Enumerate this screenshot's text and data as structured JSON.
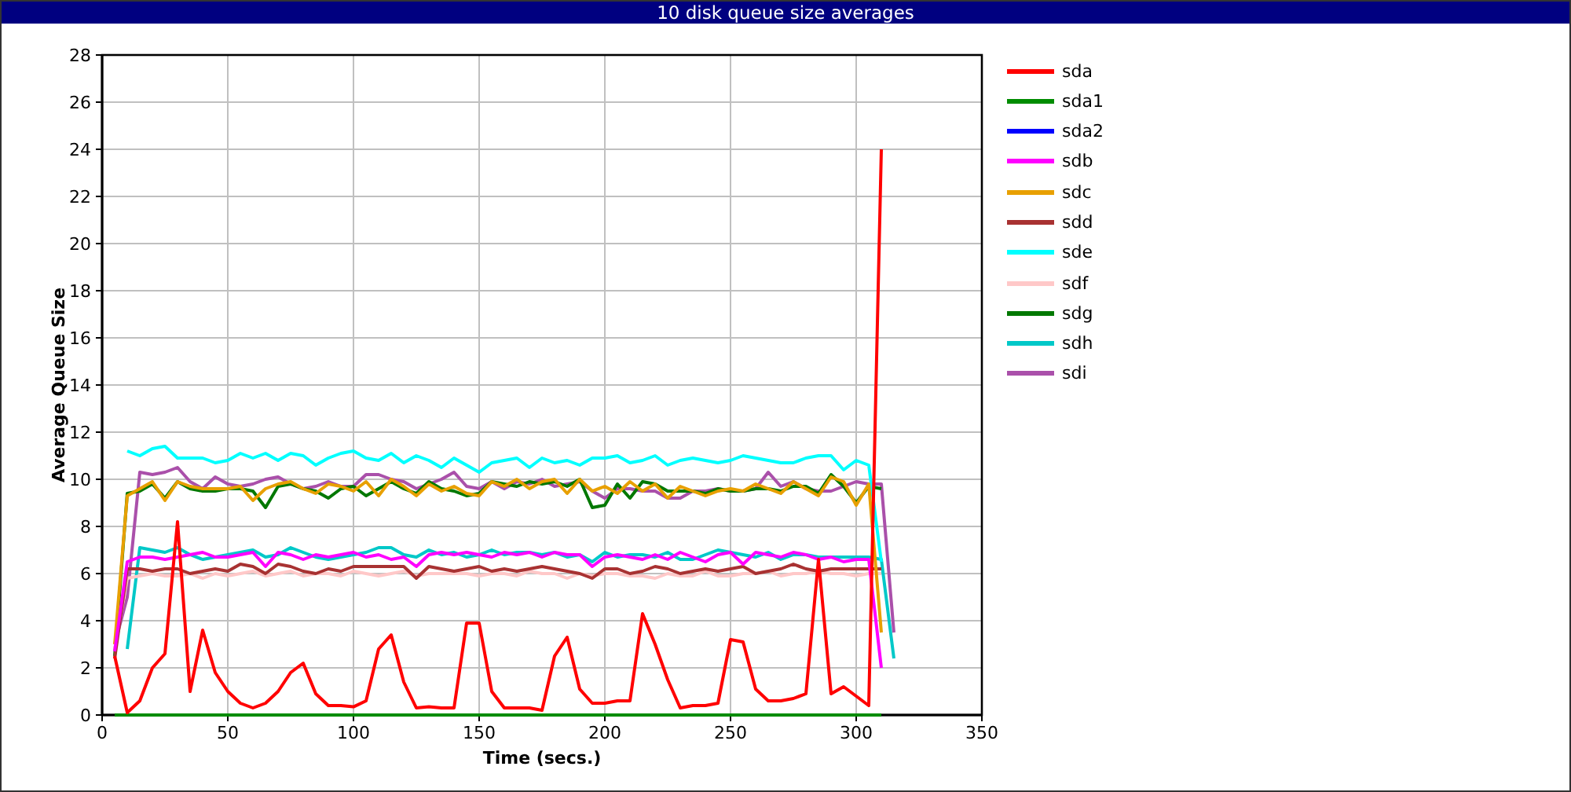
{
  "window": {
    "title": "10 disk queue size averages"
  },
  "chart": {
    "chart_data": {
      "type": "line",
      "grid": true,
      "xlabel": "Time (secs.)",
      "ylabel": "Average Queue Size",
      "xlim": [
        0,
        350
      ],
      "ylim": [
        0,
        28
      ],
      "xticks": [
        0,
        50,
        100,
        150,
        200,
        250,
        300,
        350
      ],
      "yticks": [
        0,
        2,
        4,
        6,
        8,
        10,
        12,
        14,
        16,
        18,
        20,
        22,
        24,
        26,
        28
      ],
      "x": [
        5,
        10,
        15,
        20,
        25,
        30,
        35,
        40,
        45,
        50,
        55,
        60,
        65,
        70,
        75,
        80,
        85,
        90,
        95,
        100,
        105,
        110,
        115,
        120,
        125,
        130,
        135,
        140,
        145,
        150,
        155,
        160,
        165,
        170,
        175,
        180,
        185,
        190,
        195,
        200,
        205,
        210,
        215,
        220,
        225,
        230,
        235,
        240,
        245,
        250,
        255,
        260,
        265,
        270,
        275,
        280,
        285,
        290,
        295,
        300,
        305,
        310,
        315
      ],
      "series": [
        {
          "name": "sda",
          "color": "#ff0000",
          "values": [
            2.5,
            0.1,
            0.6,
            2.0,
            2.6,
            8.2,
            1.0,
            3.6,
            1.8,
            1.0,
            0.5,
            0.3,
            0.5,
            1.0,
            1.8,
            2.2,
            0.9,
            0.4,
            0.4,
            0.35,
            0.6,
            2.8,
            3.4,
            1.4,
            0.3,
            0.35,
            0.3,
            0.3,
            3.9,
            3.9,
            1.0,
            0.3,
            0.3,
            0.3,
            0.2,
            2.5,
            3.3,
            1.1,
            0.5,
            0.5,
            0.6,
            0.6,
            4.3,
            3.0,
            1.5,
            0.3,
            0.4,
            0.4,
            0.5,
            3.2,
            3.1,
            1.1,
            0.6,
            0.6,
            0.7,
            0.9,
            6.6,
            0.9,
            1.2,
            0.8,
            0.4,
            24,
            null
          ]
        },
        {
          "name": "sda1",
          "color": "#008c00",
          "values": [
            0,
            0,
            0,
            0,
            0,
            0,
            0,
            0,
            0,
            0,
            0,
            0,
            0,
            0,
            0,
            0,
            0,
            0,
            0,
            0,
            0,
            0,
            0,
            0,
            0,
            0,
            0,
            0,
            0,
            0,
            0,
            0,
            0,
            0,
            0,
            0,
            0,
            0,
            0,
            0,
            0,
            0,
            0,
            0,
            0,
            0,
            0,
            0,
            0,
            0,
            0,
            0,
            0,
            0,
            0,
            0,
            0,
            0,
            0,
            0,
            0,
            0,
            null
          ]
        },
        {
          "name": "sda2",
          "color": "#0000ff",
          "values": [
            null,
            null,
            null,
            null,
            null,
            null,
            null,
            null,
            null,
            null,
            null,
            null,
            null,
            null,
            null,
            null,
            null,
            null,
            null,
            null,
            null,
            null,
            null,
            null,
            null,
            null,
            null,
            null,
            null,
            null,
            null,
            null,
            null,
            null,
            null,
            null,
            null,
            null,
            null,
            null,
            null,
            null,
            null,
            null,
            null,
            null,
            null,
            null,
            null,
            null,
            null,
            null,
            null,
            null,
            null,
            null,
            null,
            null,
            null,
            null,
            null,
            null,
            null
          ]
        },
        {
          "name": "sdb",
          "color": "#ff00ff",
          "values": [
            2.7,
            6.5,
            6.7,
            6.7,
            6.6,
            6.7,
            6.8,
            6.9,
            6.7,
            6.7,
            6.8,
            6.9,
            6.3,
            6.9,
            6.8,
            6.6,
            6.8,
            6.7,
            6.8,
            6.9,
            6.7,
            6.8,
            6.6,
            6.7,
            6.3,
            6.8,
            6.9,
            6.8,
            6.9,
            6.8,
            6.7,
            6.9,
            6.8,
            6.9,
            6.7,
            6.9,
            6.8,
            6.8,
            6.3,
            6.7,
            6.8,
            6.7,
            6.6,
            6.8,
            6.6,
            6.9,
            6.7,
            6.5,
            6.8,
            6.9,
            6.4,
            6.9,
            6.8,
            6.7,
            6.9,
            6.8,
            6.6,
            6.7,
            6.5,
            6.6,
            6.6,
            2.0,
            null
          ]
        },
        {
          "name": "sdc",
          "color": "#e8a000",
          "values": [
            3.0,
            9.3,
            9.6,
            9.9,
            9.1,
            9.9,
            9.7,
            9.6,
            9.6,
            9.6,
            9.7,
            9.1,
            9.6,
            9.8,
            9.9,
            9.6,
            9.4,
            9.8,
            9.7,
            9.5,
            9.9,
            9.3,
            10.0,
            9.7,
            9.3,
            9.8,
            9.5,
            9.7,
            9.4,
            9.3,
            9.9,
            9.7,
            10.0,
            9.6,
            9.9,
            10.0,
            9.4,
            10.0,
            9.5,
            9.7,
            9.4,
            9.9,
            9.5,
            9.8,
            9.2,
            9.7,
            9.5,
            9.3,
            9.5,
            9.6,
            9.5,
            9.8,
            9.6,
            9.4,
            9.9,
            9.6,
            9.3,
            10.1,
            9.9,
            8.9,
            9.8,
            3.5,
            null
          ]
        },
        {
          "name": "sdd",
          "color": "#a83232",
          "values": [
            2.4,
            6.2,
            6.2,
            6.1,
            6.2,
            6.2,
            6.0,
            6.1,
            6.2,
            6.1,
            6.4,
            6.3,
            6.0,
            6.4,
            6.3,
            6.1,
            6.0,
            6.2,
            6.1,
            6.3,
            6.3,
            6.3,
            6.3,
            6.3,
            5.8,
            6.3,
            6.2,
            6.1,
            6.2,
            6.3,
            6.1,
            6.2,
            6.1,
            6.2,
            6.3,
            6.2,
            6.1,
            6.0,
            5.8,
            6.2,
            6.2,
            6.0,
            6.1,
            6.3,
            6.2,
            6.0,
            6.1,
            6.2,
            6.1,
            6.2,
            6.3,
            6.0,
            6.1,
            6.2,
            6.4,
            6.2,
            6.1,
            6.2,
            6.2,
            6.2,
            6.2,
            6.2,
            null
          ]
        },
        {
          "name": "sde",
          "color": "#00ffff",
          "values": [
            null,
            11.2,
            11.0,
            11.3,
            11.4,
            10.9,
            10.9,
            10.9,
            10.7,
            10.8,
            11.1,
            10.9,
            11.1,
            10.8,
            11.1,
            11.0,
            10.6,
            10.9,
            11.1,
            11.2,
            10.9,
            10.8,
            11.1,
            10.7,
            11.0,
            10.8,
            10.5,
            10.9,
            10.6,
            10.3,
            10.7,
            10.8,
            10.9,
            10.5,
            10.9,
            10.7,
            10.8,
            10.6,
            10.9,
            10.9,
            11.0,
            10.7,
            10.8,
            11.0,
            10.6,
            10.8,
            10.9,
            10.8,
            10.7,
            10.8,
            11.0,
            10.9,
            10.8,
            10.7,
            10.7,
            10.9,
            11.0,
            11.0,
            10.4,
            10.8,
            10.6,
            6.5,
            null
          ]
        },
        {
          "name": "sdf",
          "color": "#ffc8c8",
          "values": [
            2.8,
            5.8,
            5.9,
            6.0,
            5.9,
            5.9,
            6.0,
            5.8,
            6.0,
            5.9,
            6.0,
            6.1,
            5.9,
            6.0,
            6.1,
            5.9,
            6.0,
            6.0,
            5.9,
            6.1,
            6.0,
            5.9,
            6.0,
            6.1,
            5.9,
            6.0,
            6.0,
            6.0,
            6.0,
            5.9,
            6.0,
            6.0,
            5.9,
            6.1,
            6.0,
            6.0,
            5.8,
            6.0,
            5.9,
            6.0,
            6.0,
            5.9,
            5.9,
            5.8,
            6.0,
            5.9,
            5.9,
            6.1,
            5.9,
            5.9,
            6.0,
            6.0,
            6.1,
            5.9,
            6.0,
            6.0,
            6.1,
            6.0,
            6.0,
            5.9,
            6.0,
            6.0,
            null
          ]
        },
        {
          "name": "sdg",
          "color": "#007800",
          "values": [
            2.5,
            9.4,
            9.5,
            9.8,
            9.2,
            9.9,
            9.6,
            9.5,
            9.5,
            9.6,
            9.6,
            9.5,
            8.8,
            9.7,
            9.8,
            9.6,
            9.5,
            9.2,
            9.6,
            9.7,
            9.3,
            9.6,
            9.9,
            9.6,
            9.4,
            9.9,
            9.6,
            9.5,
            9.3,
            9.4,
            9.9,
            9.8,
            9.7,
            9.9,
            9.8,
            9.9,
            9.7,
            10.0,
            8.8,
            8.9,
            9.8,
            9.2,
            9.9,
            9.8,
            9.5,
            9.5,
            9.5,
            9.4,
            9.6,
            9.5,
            9.5,
            9.6,
            9.6,
            9.5,
            9.7,
            9.7,
            9.4,
            10.2,
            9.7,
            9.0,
            9.7,
            9.6,
            null
          ]
        },
        {
          "name": "sdh",
          "color": "#00c8c8",
          "values": [
            null,
            2.8,
            7.1,
            7.0,
            6.9,
            7.1,
            6.8,
            6.6,
            6.7,
            6.8,
            6.9,
            7.0,
            6.7,
            6.8,
            7.1,
            6.9,
            6.7,
            6.6,
            6.7,
            6.8,
            6.9,
            7.1,
            7.1,
            6.8,
            6.7,
            7.0,
            6.8,
            6.9,
            6.7,
            6.8,
            7.0,
            6.8,
            6.9,
            6.9,
            6.8,
            6.9,
            6.7,
            6.8,
            6.5,
            6.9,
            6.7,
            6.8,
            6.8,
            6.7,
            6.9,
            6.6,
            6.6,
            6.8,
            7.0,
            6.9,
            6.8,
            6.7,
            6.9,
            6.6,
            6.8,
            6.8,
            6.7,
            6.7,
            6.7,
            6.7,
            6.7,
            6.6,
            2.4
          ]
        },
        {
          "name": "sdi",
          "color": "#aa50aa",
          "values": [
            3.0,
            5.0,
            10.3,
            10.2,
            10.3,
            10.5,
            9.9,
            9.6,
            10.1,
            9.8,
            9.7,
            9.8,
            10.0,
            10.1,
            9.8,
            9.6,
            9.7,
            9.9,
            9.7,
            9.7,
            10.2,
            10.2,
            10.0,
            9.9,
            9.6,
            9.8,
            10.0,
            10.3,
            9.7,
            9.6,
            9.9,
            9.6,
            9.9,
            9.8,
            10.0,
            9.7,
            9.8,
            9.9,
            9.5,
            9.2,
            9.6,
            9.6,
            9.5,
            9.5,
            9.2,
            9.2,
            9.5,
            9.5,
            9.6,
            9.5,
            9.5,
            9.6,
            10.3,
            9.7,
            9.9,
            9.6,
            9.5,
            9.5,
            9.7,
            9.9,
            9.8,
            9.8,
            3.5
          ]
        }
      ]
    }
  }
}
